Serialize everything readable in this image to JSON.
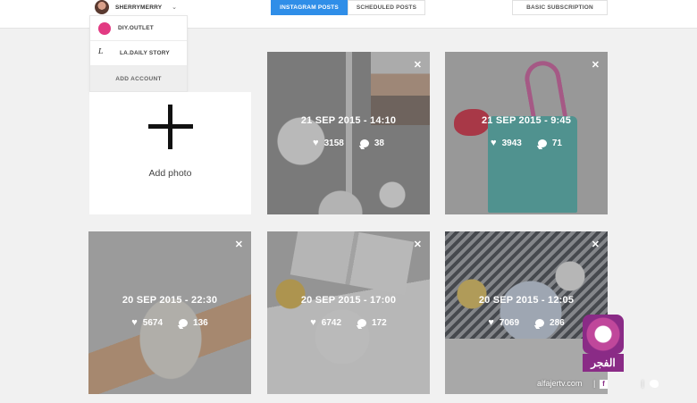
{
  "header": {
    "account": {
      "name": "SHERRYMERRY"
    },
    "tabs": [
      {
        "label": "INSTAGRAM POSTS",
        "active": true
      },
      {
        "label": "SCHEDULED POSTS",
        "active": false
      }
    ],
    "subscription_label": "BASIC SUBSCRIPTION"
  },
  "dropdown": {
    "accounts": [
      {
        "label": "DIY.OUTLET",
        "icon": "pink-circle-avatar"
      },
      {
        "label": "LA.DAILY STORY",
        "icon": "script-logo-avatar"
      }
    ],
    "add_label": "ADD ACCOUNT"
  },
  "add_photo": {
    "label": "Add photo"
  },
  "posts": [
    {
      "date": "21 SEP 2015 - 14:10",
      "likes": "3158",
      "comments": "38"
    },
    {
      "date": "21 SEP 2015 - 9:45",
      "likes": "3943",
      "comments": "71"
    },
    {
      "date": "20 SEP 2015 - 22:30",
      "likes": "5674",
      "comments": "136"
    },
    {
      "date": "20 SEP 2015 - 17:00",
      "likes": "6742",
      "comments": "172"
    },
    {
      "date": "20 SEP 2015 - 12:05",
      "likes": "7069",
      "comments": "286"
    }
  ],
  "watermark": {
    "logo_text": "الفجر",
    "site": "alfajertv.com",
    "divider": "|"
  },
  "colors": {
    "accent": "#2f8ee8",
    "watermark": "#8a2b86"
  }
}
